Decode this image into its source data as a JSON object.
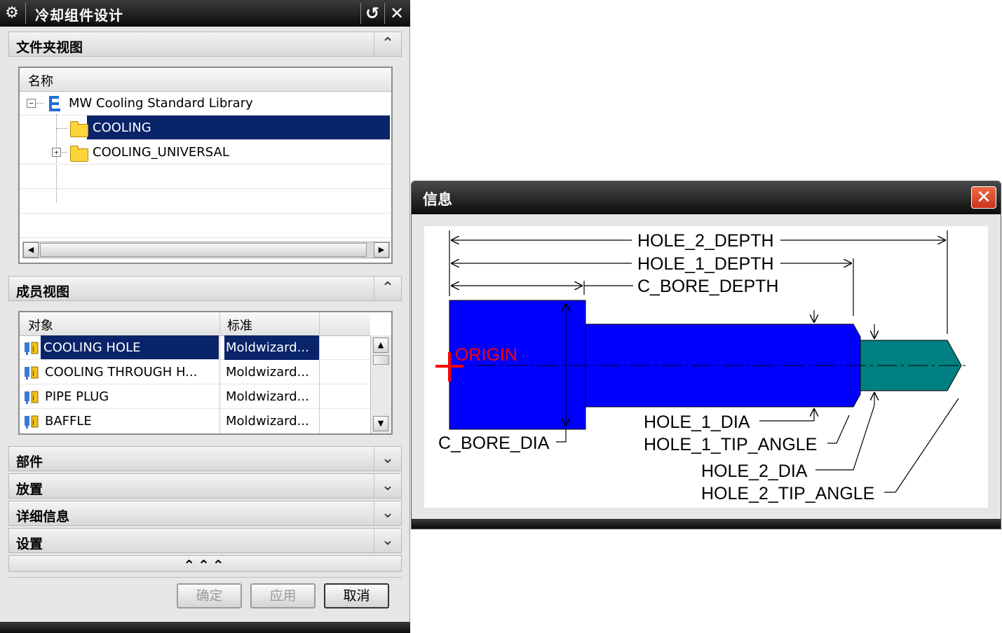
{
  "dialog": {
    "title": "冷却组件设计",
    "sections": {
      "folder_view": "文件夹视图",
      "member_view": "成员视图",
      "parts": "部件",
      "placement": "放置",
      "details": "详细信息",
      "settings": "设置"
    },
    "folder_tree": {
      "column_header": "名称",
      "items": [
        {
          "label": "MW Cooling Standard Library"
        },
        {
          "label": "COOLING"
        },
        {
          "label": "COOLING_UNIVERSAL"
        }
      ]
    },
    "member_table": {
      "headers": [
        "对象",
        "标准"
      ],
      "rows": [
        {
          "object": "COOLING HOLE",
          "standard": "Moldwizard..."
        },
        {
          "object": "COOLING THROUGH H...",
          "standard": "Moldwizard..."
        },
        {
          "object": "PIPE PLUG",
          "standard": "Moldwizard..."
        },
        {
          "object": "BAFFLE",
          "standard": "Moldwizard..."
        }
      ]
    },
    "more_glyph": "⌃⌃⌃",
    "buttons": {
      "ok": "确定",
      "apply": "应用",
      "cancel": "取消"
    }
  },
  "info_window": {
    "title": "信息",
    "labels": {
      "hole2_depth": "HOLE_2_DEPTH",
      "hole1_depth": "HOLE_1_DEPTH",
      "cbore_depth": "C_BORE_DEPTH",
      "origin": "ORIGIN",
      "cbore_dia": "C_BORE_DIA",
      "hole1_dia": "HOLE_1_DIA",
      "hole1_tip_angle": "HOLE_1_TIP_ANGLE",
      "hole2_dia": "HOLE_2_DIA",
      "hole2_tip_angle": "HOLE_2_TIP_ANGLE"
    },
    "colors": {
      "cbore": "#0000ff",
      "hole1": "#0000ff",
      "hole2": "#008080",
      "origin": "#ff0000"
    }
  },
  "icons": {
    "gear": "gear-icon",
    "reset": "reset-icon",
    "close": "close-icon",
    "collapse": "chevron-up-icon",
    "expand": "chevron-down-icon",
    "folder": "folder-icon",
    "library": "library-icon",
    "component": "component-icon"
  }
}
